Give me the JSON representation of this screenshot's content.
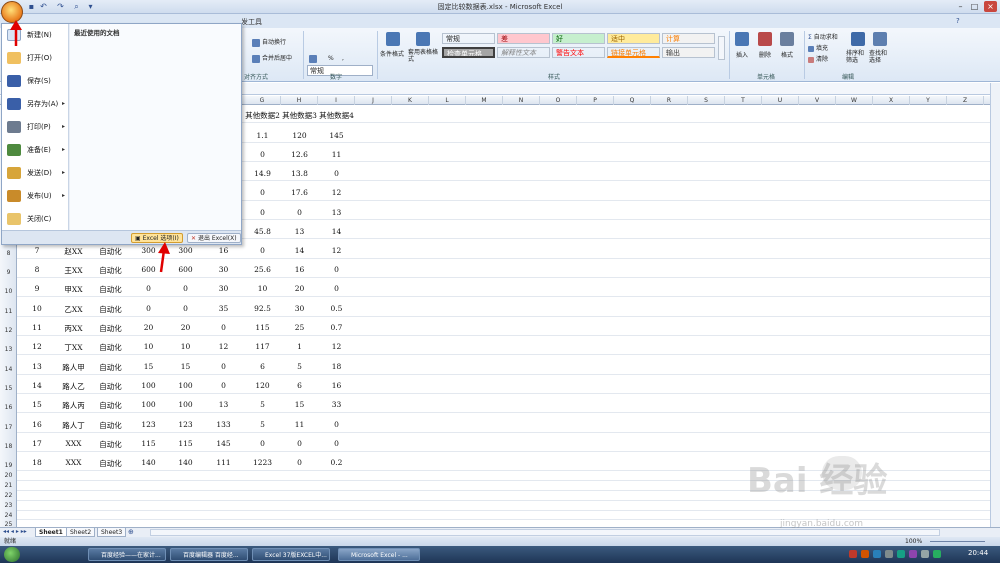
{
  "window": {
    "title": "固定比较数据表.xlsx - Microsoft Excel",
    "tools_tab": "发工具"
  },
  "ribbon": {
    "wrap_text": "自动换行",
    "merge_center": "合并后居中",
    "number_format": "常规",
    "percent": "%",
    "thousands": ",",
    "group_alignment": "对齐方式",
    "group_number": "数字",
    "group_styles": "样式",
    "group_cells": "单元格",
    "group_editing": "编辑",
    "conditional_format": "条件格式",
    "format_as_table": "套用表格格式",
    "styles": [
      {
        "label": "常规",
        "bg": "#ffffff",
        "color": "#222222"
      },
      {
        "label": "差",
        "bg": "#ffc7ce",
        "color": "#9c0006"
      },
      {
        "label": "好",
        "bg": "#c6efce",
        "color": "#006100"
      },
      {
        "label": "适中",
        "bg": "#ffeb9c",
        "color": "#9c6500"
      },
      {
        "label": "计算",
        "bg": "#f2f2f2",
        "color": "#fa7d00"
      },
      {
        "label": "检查单元格",
        "bg": "#a5a5a5",
        "color": "#ffffff"
      },
      {
        "label": "解释性文本",
        "bg": "#ffffff",
        "color": "#7f7f7f"
      },
      {
        "label": "警告文本",
        "bg": "#ffffff",
        "color": "#ff0000"
      },
      {
        "label": "链接单元格",
        "bg": "#ffffff",
        "color": "#fa7d00"
      },
      {
        "label": "输出",
        "bg": "#f2f2f2",
        "color": "#3f3f3f"
      }
    ],
    "insert": "插入",
    "delete": "删除",
    "format": "格式",
    "autosum": "自动求和",
    "fill": "填充",
    "clear": "清除",
    "sort_filter": "排序和筛选",
    "find_select": "查找和选择"
  },
  "office_menu": {
    "recent_title": "最近使用的文档",
    "items": [
      {
        "label": "新建(N)",
        "color": "#d9e6f7",
        "arrow": ""
      },
      {
        "label": "打开(O)",
        "color": "#f0c060",
        "arrow": ""
      },
      {
        "label": "保存(S)",
        "color": "#3a5fa8",
        "arrow": ""
      },
      {
        "label": "另存为(A)",
        "color": "#3a5fa8",
        "arrow": "▸"
      },
      {
        "label": "打印(P)",
        "color": "#6d7b8f",
        "arrow": "▸"
      },
      {
        "label": "准备(E)",
        "color": "#4e8a3f",
        "arrow": "▸"
      },
      {
        "label": "发送(D)",
        "color": "#d7a53a",
        "arrow": "▸"
      },
      {
        "label": "发布(U)",
        "color": "#c98b2a",
        "arrow": "▸"
      },
      {
        "label": "关闭(C)",
        "color": "#e9c46a",
        "arrow": ""
      }
    ],
    "excel_options": "Excel 选项(I)",
    "exit_excel": "退出 Excel(X)"
  },
  "columns": [
    "G",
    "H",
    "I",
    "J",
    "K",
    "L",
    "M",
    "N",
    "O",
    "P",
    "Q",
    "R",
    "S",
    "T",
    "U",
    "V",
    "W",
    "X",
    "Y",
    "Z"
  ],
  "row_numbers": [
    "8",
    "9",
    "10",
    "11",
    "12",
    "13",
    "14",
    "15",
    "16",
    "17",
    "18",
    "19",
    "20",
    "21",
    "22",
    "23",
    "24",
    "25"
  ],
  "table": {
    "header_partial": [
      "其他数据2",
      "其他数据3",
      "其他数据4"
    ],
    "partial_rows": [
      [
        "1.1",
        "120",
        "145"
      ],
      [
        "0",
        "12.6",
        "11"
      ],
      [
        "14.9",
        "13.8",
        "0"
      ],
      [
        "0",
        "17.6",
        "12"
      ],
      [
        "0",
        "0",
        "13"
      ],
      [
        "45.8",
        "13",
        "14"
      ]
    ],
    "full_rows": [
      [
        "7",
        "赵XX",
        "自动化",
        "300",
        "300",
        "16",
        "0",
        "14",
        "12"
      ],
      [
        "8",
        "王XX",
        "自动化",
        "600",
        "600",
        "30",
        "25.6",
        "16",
        "0"
      ],
      [
        "9",
        "甲XX",
        "自动化",
        "0",
        "0",
        "30",
        "10",
        "20",
        "0"
      ],
      [
        "10",
        "乙XX",
        "自动化",
        "0",
        "0",
        "35",
        "92.5",
        "30",
        "0.5"
      ],
      [
        "11",
        "丙XX",
        "自动化",
        "20",
        "20",
        "0",
        "115",
        "25",
        "0.7"
      ],
      [
        "12",
        "丁XX",
        "自动化",
        "10",
        "10",
        "12",
        "117",
        "1",
        "12"
      ],
      [
        "13",
        "路人甲",
        "自动化",
        "15",
        "15",
        "0",
        "6",
        "5",
        "18"
      ],
      [
        "14",
        "路人乙",
        "自动化",
        "100",
        "100",
        "0",
        "120",
        "6",
        "16"
      ],
      [
        "15",
        "路人丙",
        "自动化",
        "100",
        "100",
        "13",
        "5",
        "15",
        "33"
      ],
      [
        "16",
        "路人丁",
        "自动化",
        "123",
        "123",
        "133",
        "5",
        "11",
        "0"
      ],
      [
        "17",
        "XXX",
        "自动化",
        "115",
        "115",
        "145",
        "0",
        "0",
        "0"
      ],
      [
        "18",
        "XXX",
        "自动化",
        "140",
        "140",
        "111",
        "1223",
        "0",
        "0.2"
      ]
    ]
  },
  "sheets": [
    "Sheet1",
    "Sheet2",
    "Sheet3"
  ],
  "status": {
    "ready": "就绪",
    "zoom": "100%"
  },
  "taskbar": {
    "items": [
      "百度经验——在家计...",
      "百度编辑器 百度经...",
      "Excel 37版EXCEL中...",
      "Microsoft Excel - ..."
    ],
    "clock": "20:44"
  },
  "watermark": {
    "logo": "Bai 经验",
    "url": "jingyan.baidu.com"
  }
}
